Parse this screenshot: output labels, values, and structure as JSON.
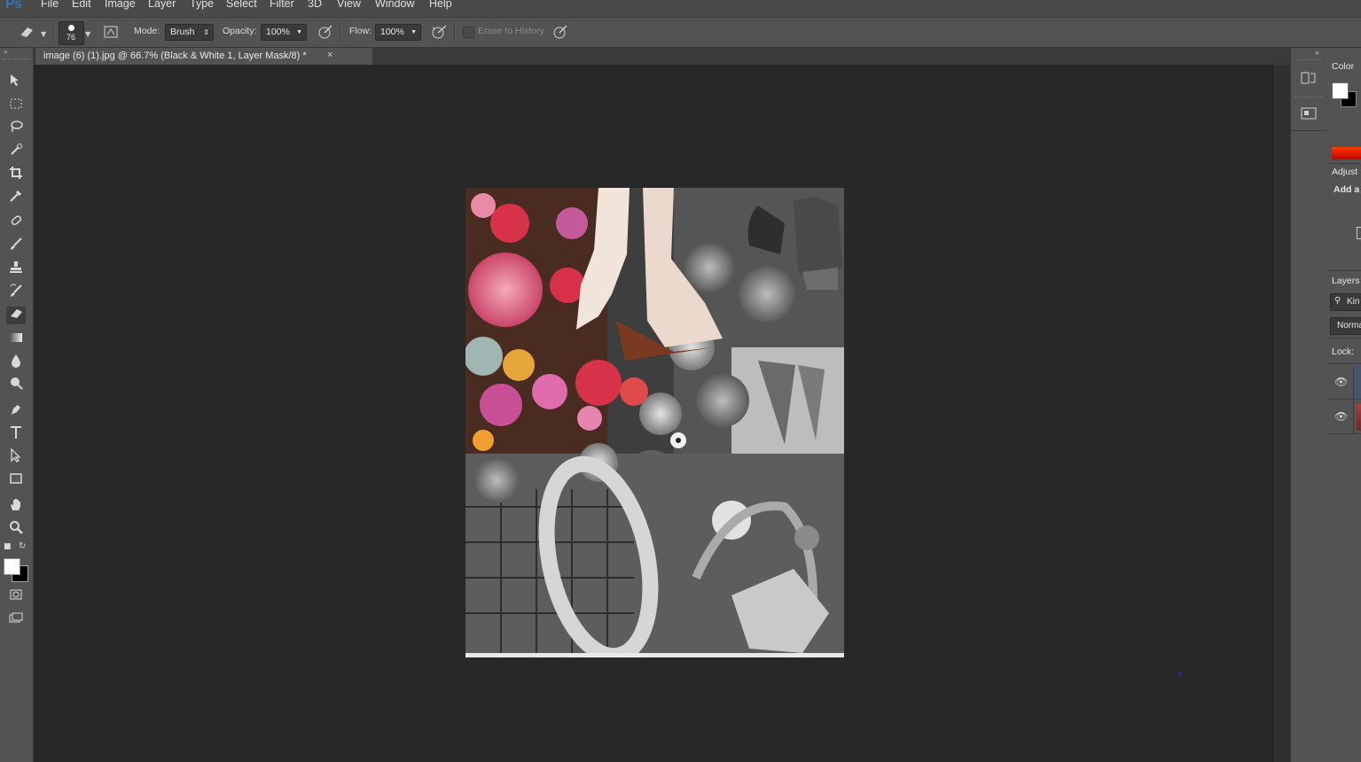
{
  "app": {
    "logo": "Ps"
  },
  "menu": [
    "File",
    "Edit",
    "Image",
    "Layer",
    "Type",
    "Select",
    "Filter",
    "3D",
    "View",
    "Window",
    "Help"
  ],
  "options_bar": {
    "brush_size": "76",
    "mode_label": "Mode:",
    "mode_value": "Brush",
    "opacity_label": "Opacity:",
    "opacity_value": "100%",
    "flow_label": "Flow:",
    "flow_value": "100%",
    "erase_history_label": "Erase to History"
  },
  "document": {
    "tab_title": "image (6) (1).jpg @ 66.7% (Black & White 1, Layer Mask/8) *",
    "close_glyph": "×"
  },
  "tools": [
    "move-tool",
    "marquee-tool",
    "lasso-tool",
    "quick-select-tool",
    "crop-tool",
    "eyedropper-tool",
    "healing-brush-tool",
    "brush-tool",
    "clone-stamp-tool",
    "history-brush-tool",
    "eraser-tool",
    "gradient-tool",
    "blur-tool",
    "dodge-tool",
    "pen-tool",
    "type-tool",
    "path-select-tool",
    "rectangle-tool",
    "hand-tool",
    "zoom-tool"
  ],
  "active_tool": "eraser-tool",
  "colors": {
    "foreground": "#ffffff",
    "background": "#000000",
    "accent": "#2f78b6"
  },
  "right_panel": {
    "color_title": "Color",
    "adjustments_title": "Adjust",
    "adjustments_sub": "Add a",
    "layers_title": "Layers",
    "kind_label": "Kin",
    "blend_value": "Norma",
    "lock_label": "Lock:"
  }
}
